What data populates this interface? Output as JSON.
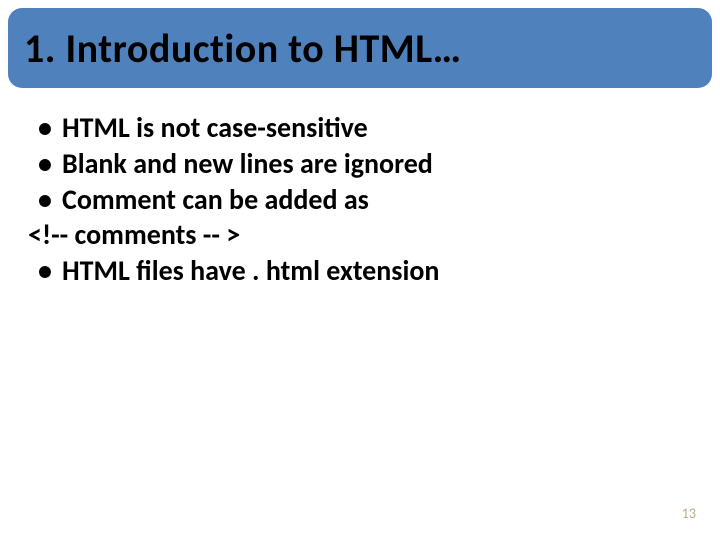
{
  "title": "1. Introduction to HTML…",
  "bullets": {
    "b1": "HTML is not case-sensitive",
    "b2": "Blank and new lines are ignored",
    "b3": "Comment can be added as",
    "comment_example": "<!-- comments -- >",
    "b4": "HTML files have . html extension"
  },
  "page_number": "13"
}
